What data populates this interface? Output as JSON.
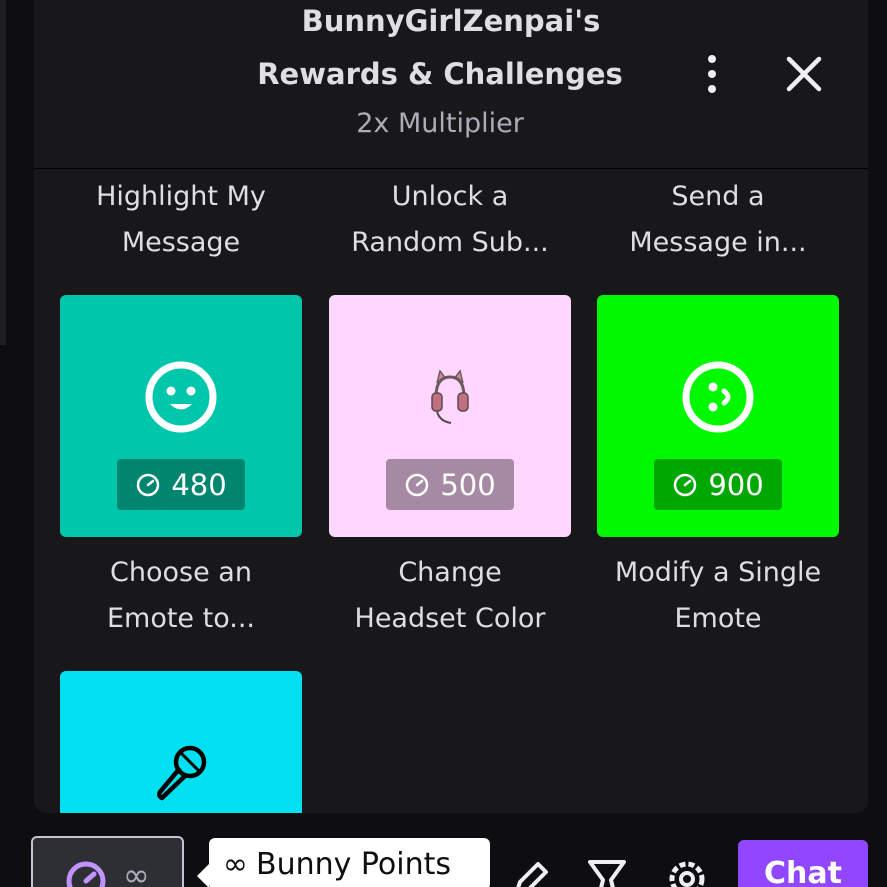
{
  "header": {
    "title_line1": "BunnyGirlZenpai's",
    "title_line2": "Rewards & Challenges",
    "subtitle": "2x Multiplier"
  },
  "rewards_top_row": [
    {
      "label_line1": "Highlight My",
      "label_line2": "Message",
      "accent": "#ff6905"
    },
    {
      "label_line1": "Unlock a",
      "label_line2": "Random Sub...",
      "accent": "#8b0ad6"
    },
    {
      "label_line1": "Send a",
      "label_line2": "Message in...",
      "accent": "#9147ff"
    }
  ],
  "rewards": [
    {
      "label_line1": "Choose an",
      "label_line2": "Emote to...",
      "cost": "480",
      "icon": "smiley-face-icon",
      "bg": "#00c7ac",
      "price_bg": "#00866f"
    },
    {
      "label_line1": "Change",
      "label_line2": "Headset Color",
      "cost": "500",
      "icon": "cat-ear-headset-icon",
      "bg": "#ffd6fd",
      "price_bg": "#a68aa4"
    },
    {
      "label_line1": "Modify a Single",
      "label_line2": "Emote",
      "cost": "900",
      "icon": "winking-face-icon",
      "bg": "#00f800",
      "price_bg": "#00a700"
    },
    {
      "icon": "microphone-icon",
      "bg": "#00e0f0"
    }
  ],
  "bottom_bar": {
    "points_value": "∞",
    "tooltip_symbol": "∞",
    "tooltip_text": "Bunny Points",
    "chat_label": "Chat",
    "chat_color": "#9147ff"
  }
}
